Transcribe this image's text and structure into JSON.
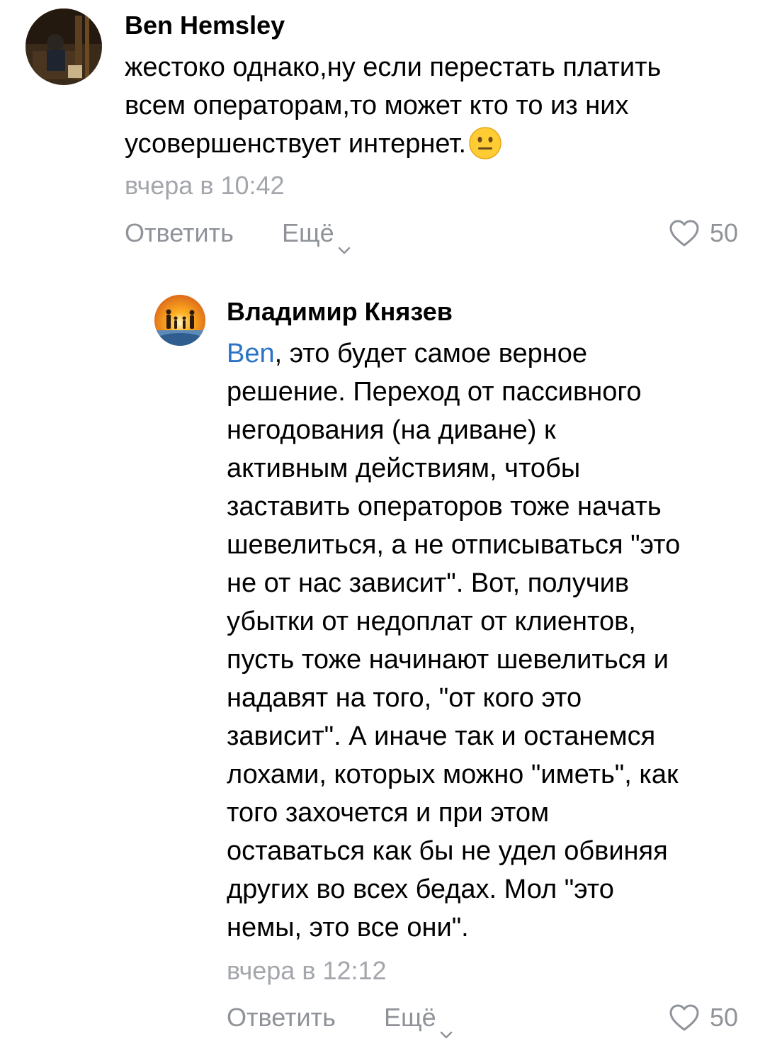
{
  "comments": [
    {
      "author": "Ben Hemsley",
      "avatar_icon": "photo-avatar-icon",
      "lines": [
        "жестоко однако,ну если перестать платить",
        "всем операторам,то может кто то из них",
        "усовершенствует интернет."
      ],
      "emoji": "neutral-face-emoji",
      "time": "вчера в 10:42",
      "reply_label": "Ответить",
      "more_label": "Ещё",
      "likes": "50"
    },
    {
      "author": "Владимир Князев",
      "avatar_icon": "sunset-family-avatar-icon",
      "mention": "Ben",
      "first_line_rest": ", это будет самое верное",
      "lines": [
        "решение. Переход от пассивного",
        "негодования (на диване) к",
        "активным действиям, чтобы",
        "заставить операторов тоже начать",
        "шевелиться, а не отписываться \"это",
        "не от нас зависит\". Вот, получив",
        "убытки от недоплат от клиентов,",
        "пусть тоже начинают шевелиться и",
        "надавят на того, \"от кого это",
        "зависит\". А иначе так и останемся",
        "лохами, которых можно \"иметь\", как",
        "того захочется и при этом",
        "оставаться как бы не удел обвиняя",
        "других во всех бедах. Мол \"это",
        "немы, это все они\"."
      ],
      "time": "вчера в 12:12",
      "reply_label": "Ответить",
      "more_label": "Ещё",
      "likes": "50"
    }
  ],
  "colors": {
    "mention": "#2a73c6",
    "muted": "#8f9399",
    "time": "#a3a6ab"
  }
}
